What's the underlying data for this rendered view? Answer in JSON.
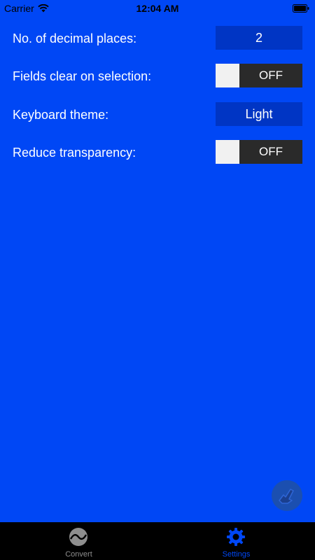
{
  "status_bar": {
    "carrier": "Carrier",
    "time": "12:04 AM"
  },
  "settings": {
    "decimal_places": {
      "label": "No. of decimal places:",
      "value": "2"
    },
    "fields_clear": {
      "label": "Fields clear on selection:",
      "state": "OFF"
    },
    "keyboard_theme": {
      "label": "Keyboard theme:",
      "value": "Light"
    },
    "reduce_transparency": {
      "label": "Reduce transparency:",
      "state": "OFF"
    }
  },
  "tab_bar": {
    "tabs": [
      {
        "label": "Convert",
        "icon": "convert-icon",
        "active": false
      },
      {
        "label": "Settings",
        "icon": "gear-icon",
        "active": true
      }
    ],
    "active_color": "#0047f5",
    "inactive_color": "#8e8e8e"
  },
  "colors": {
    "background": "#0047f5",
    "value_box": "#0035c4",
    "toggle_off": "#2a2a2a"
  }
}
